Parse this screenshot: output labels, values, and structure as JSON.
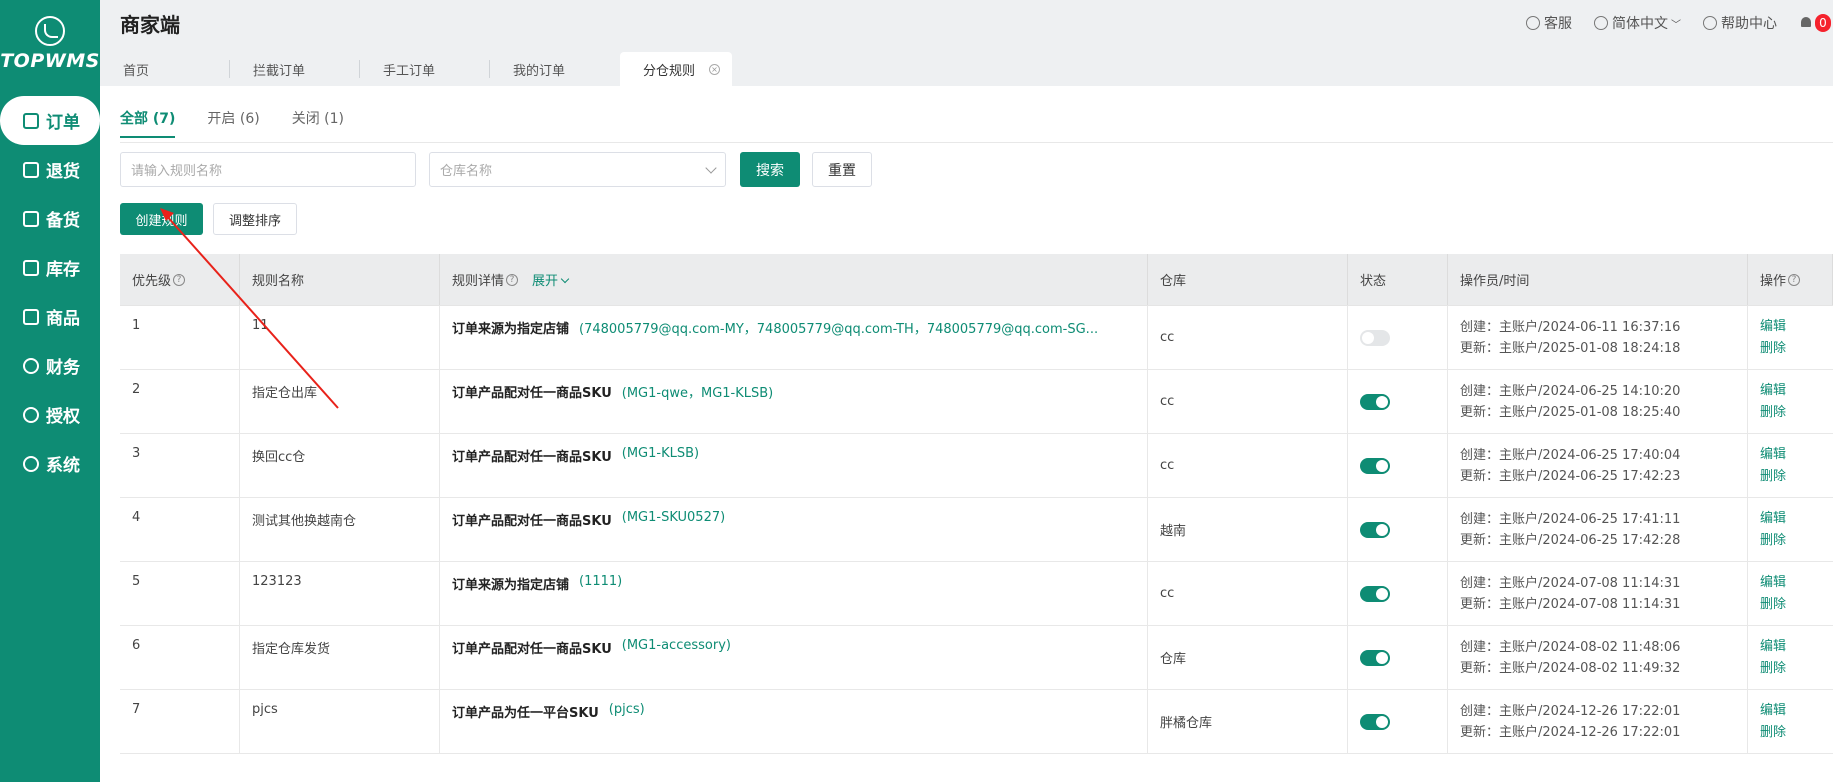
{
  "sidebar": {
    "logo_text": "TOPWMS",
    "items": [
      {
        "label": "订单",
        "icon": "order-icon"
      },
      {
        "label": "退货",
        "icon": "return-icon"
      },
      {
        "label": "备货",
        "icon": "stock-up-icon"
      },
      {
        "label": "库存",
        "icon": "inventory-icon"
      },
      {
        "label": "商品",
        "icon": "product-icon"
      },
      {
        "label": "财务",
        "icon": "finance-icon"
      },
      {
        "label": "授权",
        "icon": "auth-icon"
      },
      {
        "label": "系统",
        "icon": "settings-icon"
      }
    ]
  },
  "header": {
    "title": "商家端",
    "service": "客服",
    "language": "简体中文",
    "help": "帮助中心",
    "notification_count": "0"
  },
  "tabs": [
    "首页",
    "拦截订单",
    "手工订单",
    "我的订单",
    "分仓规则"
  ],
  "status_tabs": [
    "全部 (7)",
    "开启 (6)",
    "关闭 (1)"
  ],
  "filters": {
    "rule_name_placeholder": "请输入规则名称",
    "warehouse_placeholder": "仓库名称",
    "search": "搜索",
    "reset": "重置"
  },
  "actions": {
    "create": "创建规则",
    "sort": "调整排序"
  },
  "table": {
    "headers": {
      "priority": "优先级",
      "name": "规则名称",
      "detail": "规则详情",
      "expand": "展开",
      "warehouse": "仓库",
      "status": "状态",
      "operator": "操作员/时间",
      "action": "操作"
    },
    "rows": [
      {
        "priority": "1",
        "name": "11",
        "detail_label": "订单来源为指定店铺",
        "detail_value": "(748005779@qq.com-MY，748005779@qq.com-TH，748005779@qq.com-SG...",
        "warehouse": "cc",
        "enabled": false,
        "created": "创建：主账户/2024-06-11 16:37:16",
        "updated": "更新：主账户/2025-01-08 18:24:18",
        "edit": "编辑",
        "delete": "删除"
      },
      {
        "priority": "2",
        "name": "指定仓出库",
        "detail_label": "订单产品配对任一商品SKU",
        "detail_value": "(MG1-qwe，MG1-KLSB)",
        "warehouse": "cc",
        "enabled": true,
        "created": "创建：主账户/2024-06-25 14:10:20",
        "updated": "更新：主账户/2025-01-08 18:25:40",
        "edit": "编辑",
        "delete": "删除"
      },
      {
        "priority": "3",
        "name": "换回cc仓",
        "detail_label": "订单产品配对任一商品SKU",
        "detail_value": "(MG1-KLSB)",
        "warehouse": "cc",
        "enabled": true,
        "created": "创建：主账户/2024-06-25 17:40:04",
        "updated": "更新：主账户/2024-06-25 17:42:23",
        "edit": "编辑",
        "delete": "删除"
      },
      {
        "priority": "4",
        "name": "测试其他换越南仓",
        "detail_label": "订单产品配对任一商品SKU",
        "detail_value": "(MG1-SKU0527)",
        "warehouse": "越南",
        "enabled": true,
        "created": "创建：主账户/2024-06-25 17:41:11",
        "updated": "更新：主账户/2024-06-25 17:42:28",
        "edit": "编辑",
        "delete": "删除"
      },
      {
        "priority": "5",
        "name": "123123",
        "detail_label": "订单来源为指定店铺",
        "detail_value": "(1111)",
        "warehouse": "cc",
        "enabled": true,
        "created": "创建：主账户/2024-07-08 11:14:31",
        "updated": "更新：主账户/2024-07-08 11:14:31",
        "edit": "编辑",
        "delete": "删除"
      },
      {
        "priority": "6",
        "name": "指定仓库发货",
        "detail_label": "订单产品配对任一商品SKU",
        "detail_value": "(MG1-accessory)",
        "warehouse": "仓库",
        "enabled": true,
        "created": "创建：主账户/2024-08-02 11:48:06",
        "updated": "更新：主账户/2024-08-02 11:49:32",
        "edit": "编辑",
        "delete": "删除"
      },
      {
        "priority": "7",
        "name": "pjcs",
        "detail_label": "订单产品为任一平台SKU",
        "detail_value": "(pjcs)",
        "warehouse": "胖橘仓库",
        "enabled": true,
        "created": "创建：主账户/2024-12-26 17:22:01",
        "updated": "更新：主账户/2024-12-26 17:22:01",
        "edit": "编辑",
        "delete": "删除"
      }
    ]
  },
  "colors": {
    "brand": "#0e8c74",
    "annotation_arrow": "#e8221a"
  }
}
